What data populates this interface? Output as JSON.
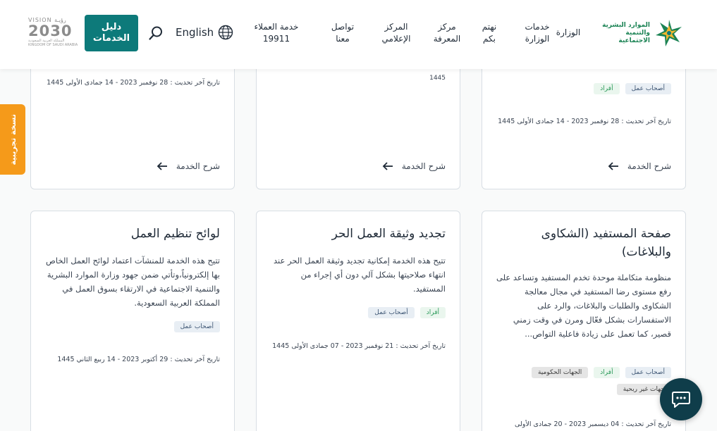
{
  "header": {
    "logo_text": "الموارد البشرية والتنمية الاجتماعية",
    "nav": [
      {
        "label": "الوزارة"
      },
      {
        "label": "خدمات الوزارة"
      },
      {
        "label": "نهتم بكم"
      },
      {
        "label": "مركز المعرفة"
      },
      {
        "label": "المركز الإعلامي"
      },
      {
        "label": "تواصل معنا"
      },
      {
        "label": "خدمة العملاء 19911"
      }
    ],
    "language": "English",
    "guide_button": "دليل الخدمات",
    "vision": {
      "top": "VISION رؤيـة",
      "year": "2030",
      "sub": "المملكة العربية السعودية KINGDOM OF SAUDI ARABIA"
    }
  },
  "beta_tab": "نسخة تجريبية",
  "colors": {
    "brand_green": "#1b8354",
    "guide_button": "#0d7a7a",
    "beta_tab": "#f59a1a",
    "chat_button": "#0f3d4a"
  },
  "top_cards": [
    {
      "tags": [
        "أصحاب عمل",
        "أفراد"
      ],
      "updated": "تاريخ آخر تحديث : 28 نوفمبر 2023 - 14 جمادى الأولى 1445",
      "explain": "شرح الخدمة"
    },
    {
      "fragment": "1445",
      "explain": "شرح الخدمة"
    },
    {
      "updated": "تاريخ آخر تحديث : 28 نوفمبر 2023 - 14 جمادى الأولى 1445",
      "explain": "شرح الخدمة"
    }
  ],
  "bottom_cards": [
    {
      "title": "صفحة المستفيد (الشكاوى والبلاغات)",
      "description": "منظومة متكاملة موحدة تخدم المستفيد وتساعد على رفع مستوى رضا المستفيد في مجال معالجة الشكاوى والطلبات والبلاغات، والرد على الاستفسارات بشكل فعّال ومرن في وقت زمني قصير، كما تعمل على زيادة فاعلية التواص...",
      "tags": [
        "أصحاب عمل",
        "أفراد",
        "الجهات الحكومية",
        "جهات غير ربحية"
      ],
      "updated": "تاريخ آخر تحديث : 04 ديسمبر 2023 - 20 جمادى الأولى"
    },
    {
      "title": "تجديد وثيقة العمل الحر",
      "description": "تتيح هذه الخدمة إمكانية تجديد وثيقة العمل الحر عند انتهاء صلاحيتها بشكل آلي دون أي إجراء من المستفيد.",
      "tags": [
        "أصحاب عمل",
        "أفراد"
      ],
      "updated": "تاريخ آخر تحديث : 21 نوفمبر 2023 - 07 جمادى الأولى 1445"
    },
    {
      "title": "لوائح تنظيم العمل",
      "description": "تتيح هذه الخدمة للمنشآت اعتماد لوائح العمل الخاص بها إلكترونياً،وتأتي ضمن جهود وزارة الموارد البشرية والتنمية الاجتماعية في الارتقاء بسوق العمل في المملكة العربية السعودية.",
      "tags": [
        "أصحاب عمل"
      ],
      "updated": "تاريخ آخر تحديث : 29 أكتوبر 2023 - 14 ربيع الثاني 1445"
    }
  ]
}
